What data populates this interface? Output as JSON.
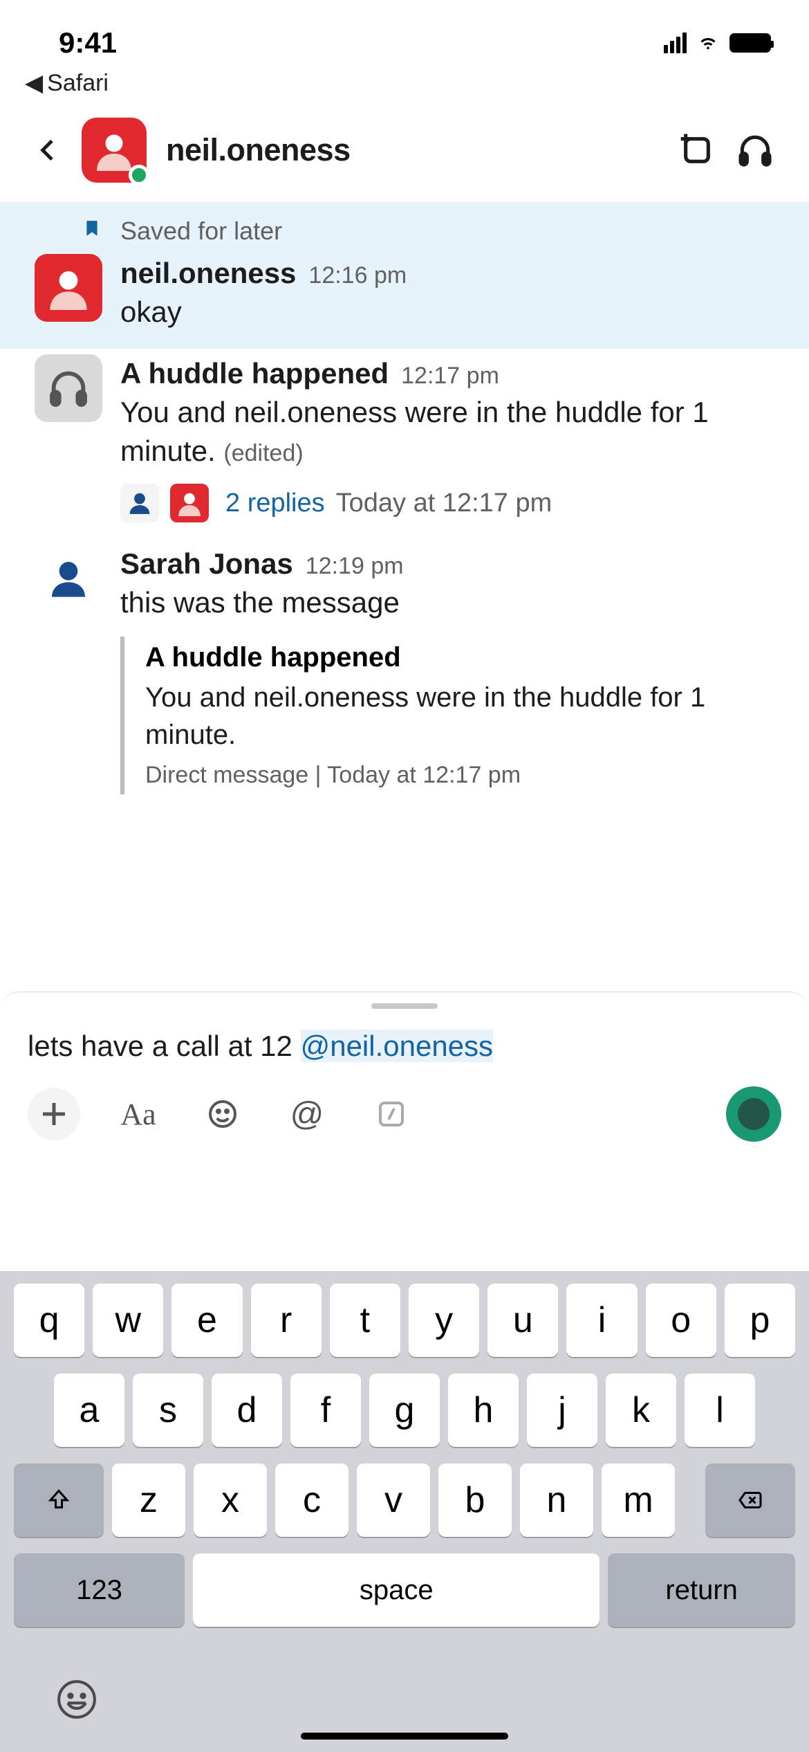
{
  "status": {
    "time": "9:41",
    "back_app": "Safari"
  },
  "header": {
    "title": "neil.oneness"
  },
  "saved": {
    "label": "Saved for later"
  },
  "messages": {
    "m1": {
      "name": "neil.oneness",
      "time": "12:16 pm",
      "text": "okay"
    },
    "m2": {
      "name": "A huddle happened",
      "time": "12:17 pm",
      "text": "You and neil.oneness were in the huddle for 1 minute.",
      "edited": "(edited)",
      "replies": "2 replies",
      "reply_time": "Today at 12:17 pm"
    },
    "m3": {
      "name": "Sarah Jonas",
      "time": "12:19 pm",
      "text": "this was the message",
      "quote": {
        "title": "A huddle happened",
        "text": "You and neil.oneness were in the huddle for 1 minute.",
        "meta": "Direct message | Today at 12:17 pm"
      }
    }
  },
  "composer": {
    "text_before": "lets have a call at 12 ",
    "mention": "@neil.oneness"
  },
  "keyboard": {
    "row1": [
      "q",
      "w",
      "e",
      "r",
      "t",
      "y",
      "u",
      "i",
      "o",
      "p"
    ],
    "row2": [
      "a",
      "s",
      "d",
      "f",
      "g",
      "h",
      "j",
      "k",
      "l"
    ],
    "row3": [
      "z",
      "x",
      "c",
      "v",
      "b",
      "n",
      "m"
    ],
    "num": "123",
    "space": "space",
    "return": "return"
  }
}
